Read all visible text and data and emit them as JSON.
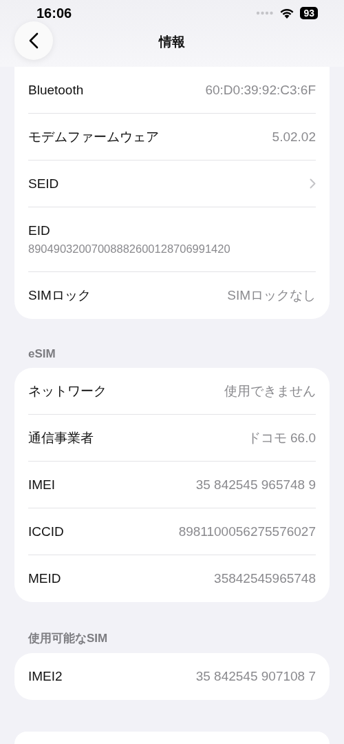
{
  "status_bar": {
    "time": "16:06",
    "battery": "93"
  },
  "nav": {
    "title": "情報"
  },
  "sections": [
    {
      "rows": [
        {
          "kind": "value",
          "label": "Bluetooth",
          "value": "60:D0:39:92:C3:6F"
        },
        {
          "kind": "value",
          "label": "モデムファームウェア",
          "value": "5.02.02"
        },
        {
          "kind": "chevron",
          "label": "SEID"
        },
        {
          "kind": "stacked",
          "label": "EID",
          "value": "89049032007008882600128706991420"
        },
        {
          "kind": "value",
          "label": "SIMロック",
          "value": "SIMロックなし"
        }
      ]
    },
    {
      "header": "eSIM",
      "rows": [
        {
          "kind": "value",
          "label": "ネットワーク",
          "value": "使用できません"
        },
        {
          "kind": "value",
          "label": "通信事業者",
          "value": "ドコモ 66.0"
        },
        {
          "kind": "value",
          "label": "IMEI",
          "value": "35 842545 965748 9"
        },
        {
          "kind": "value",
          "label": "ICCID",
          "value": "8981100056275576027"
        },
        {
          "kind": "value",
          "label": "MEID",
          "value": "35842545965748"
        }
      ]
    },
    {
      "header": "使用可能なSIM",
      "rows": [
        {
          "kind": "value",
          "label": "IMEI2",
          "value": "35 842545 907108 7"
        }
      ]
    }
  ]
}
